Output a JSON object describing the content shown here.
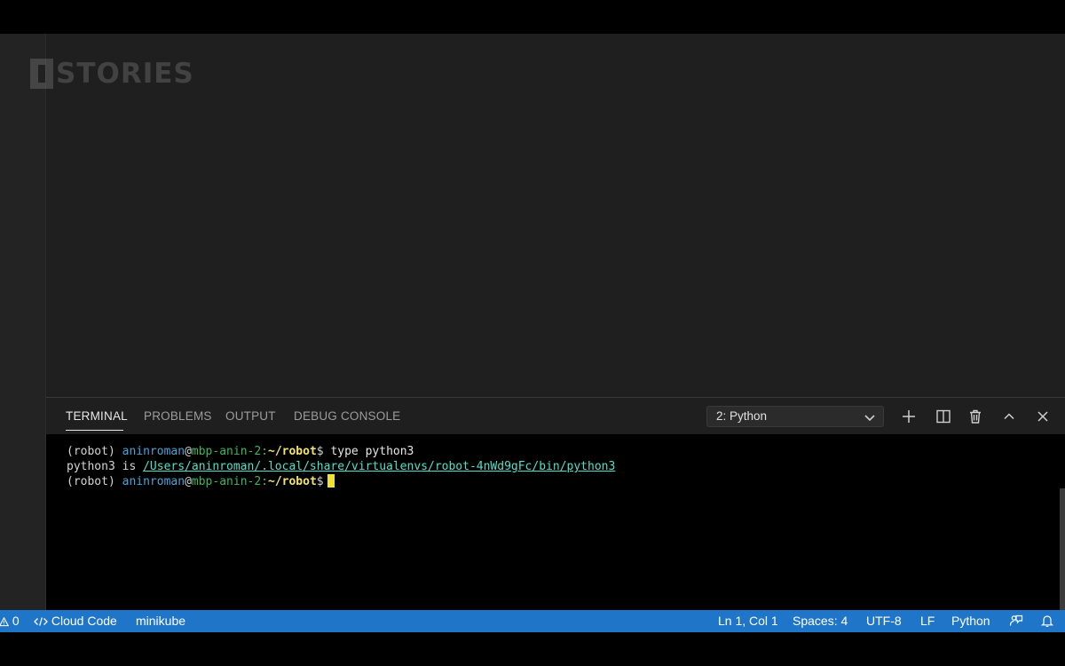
{
  "watermark": {
    "text": "STORIES"
  },
  "panel": {
    "tabs": [
      {
        "label": "TERMINAL",
        "active": true
      },
      {
        "label": "PROBLEMS",
        "active": false
      },
      {
        "label": "OUTPUT",
        "active": false
      },
      {
        "label": "DEBUG CONSOLE",
        "active": false
      }
    ],
    "terminal_select": "2: Python",
    "actions": [
      "plus-icon",
      "split-icon",
      "trash-icon",
      "chevron-up-icon",
      "close-icon"
    ]
  },
  "terminal": {
    "lines": [
      {
        "env": "(robot) ",
        "user": "aninroman",
        "at": "@",
        "host": "mbp-anin-2:",
        "path": "~/robot",
        "dollar": "$ ",
        "command": "type python3"
      },
      {
        "prefix": "python3 is ",
        "link": "/Users/aninroman/.local/share/virtualenvs/robot-4nWd9gFc/bin/python3"
      },
      {
        "env": "(robot) ",
        "user": "aninroman",
        "at": "@",
        "host": "mbp-anin-2:",
        "path": "~/robot",
        "dollar": "$"
      }
    ]
  },
  "statusbar": {
    "warnings": "0",
    "cloud_code": "Cloud Code",
    "cluster": "minikube",
    "position": "Ln 1, Col 1",
    "spaces": "Spaces: 4",
    "encoding": "UTF-8",
    "eol": "LF",
    "language": "Python",
    "background_color": "#1f76c9"
  },
  "colors": {
    "terminal_user": "#4aa3d6",
    "terminal_host": "#3fb55f",
    "terminal_path": "#f3e470",
    "terminal_link": "#4fe0c9",
    "cursor": "#f0e22f"
  }
}
